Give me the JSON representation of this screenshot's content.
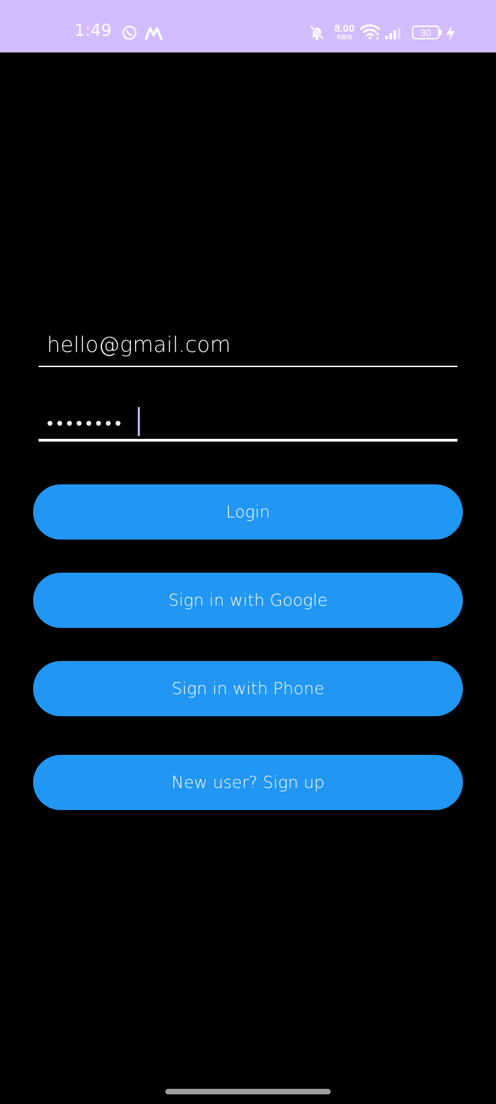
{
  "status_bar": {
    "time": "1:49",
    "network_speed_value": "8.00",
    "network_speed_unit": "KB/S",
    "battery_level": "30",
    "background_color": "#d3bcff",
    "icons": [
      "whatsapp-icon",
      "app-m-icon",
      "mute-icon",
      "wifi-icon",
      "signal-icon",
      "battery-icon",
      "charging-icon"
    ]
  },
  "login_form": {
    "email_value": "hello@gmail.com",
    "password_value": "••••••••"
  },
  "buttons": {
    "login_label": "Login",
    "google_label": "Sign in with Google",
    "phone_label": "Sign in with Phone",
    "signup_label": "New user? Sign up"
  },
  "colors": {
    "button_background": "#2196f3",
    "page_background": "#000000",
    "cursor": "#c7b6ee"
  }
}
